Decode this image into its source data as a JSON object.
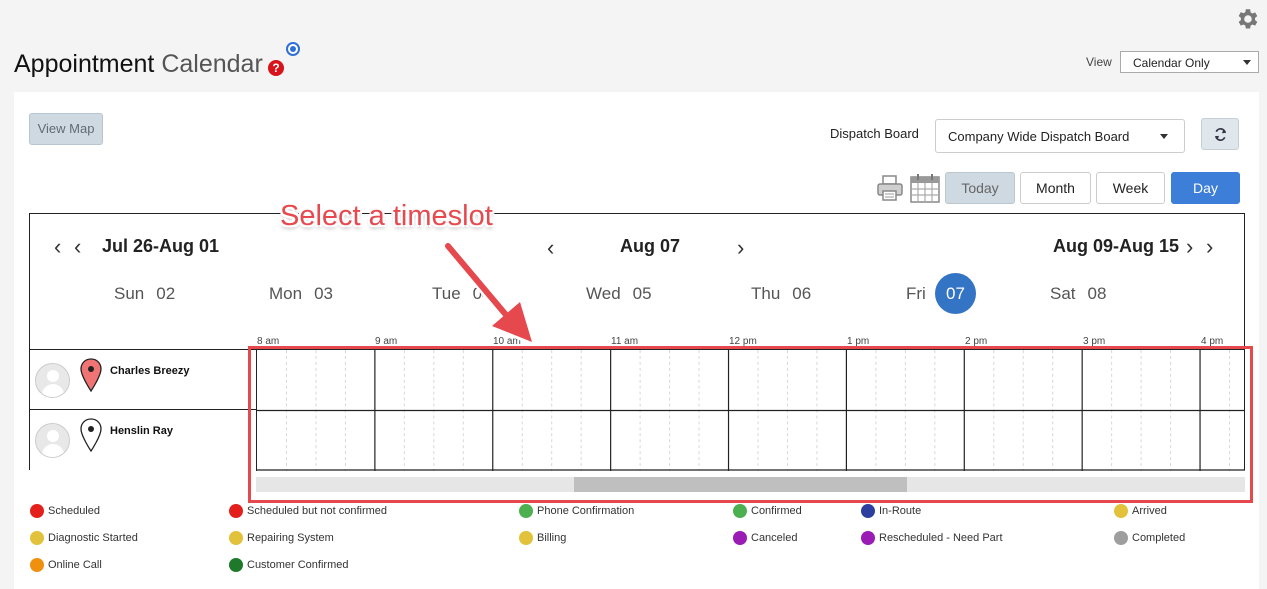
{
  "header": {
    "title_part1": "Appointment",
    "title_part2": "Calendar",
    "help_symbol": "?",
    "view_label": "View",
    "view_selected": "Calendar Only"
  },
  "toolbar": {
    "view_map_label": "View Map",
    "dispatch_label": "Dispatch Board",
    "dispatch_selected": "Company Wide Dispatch Board",
    "today_label": "Today",
    "month_label": "Month",
    "week_label": "Week",
    "day_label": "Day",
    "active_view": "Day"
  },
  "calendar": {
    "prev_range": "Jul 26-Aug 01",
    "current_date": "Aug 07",
    "next_range": "Aug 09-Aug 15",
    "days": [
      {
        "name": "Sun",
        "num": "02"
      },
      {
        "name": "Mon",
        "num": "03"
      },
      {
        "name": "Tue",
        "num": "04"
      },
      {
        "name": "Wed",
        "num": "05"
      },
      {
        "name": "Thu",
        "num": "06"
      },
      {
        "name": "Fri",
        "num": "07"
      },
      {
        "name": "Sat",
        "num": "08"
      }
    ],
    "selected_day_index": 5,
    "hours": [
      "8 am",
      "9 am",
      "10 am",
      "11 am",
      "12 pm",
      "1 pm",
      "2 pm",
      "3 pm",
      "4 pm"
    ],
    "technicians": [
      {
        "name": "Charles Breezy",
        "pin_color": "#f07474"
      },
      {
        "name": "Henslin Ray",
        "pin_color": "#ffffff"
      }
    ],
    "scroll_position": 0.32
  },
  "annotation": {
    "callout_text": "Select a timeslot",
    "color": "#e5484d"
  },
  "legend": [
    {
      "label": "Scheduled",
      "color": "#e3201b"
    },
    {
      "label": "Scheduled but not confirmed",
      "color": "#e3201b"
    },
    {
      "label": "Phone Confirmation",
      "color": "#4caf50"
    },
    {
      "label": "Confirmed",
      "color": "#4caf50"
    },
    {
      "label": "In-Route",
      "color": "#2c3e9e"
    },
    {
      "label": "Arrived",
      "color": "#e2c23a"
    },
    {
      "label": "Diagnostic Started",
      "color": "#e2c23a"
    },
    {
      "label": "Repairing System",
      "color": "#e2c23a"
    },
    {
      "label": "Billing",
      "color": "#e2c23a"
    },
    {
      "label": "Canceled",
      "color": "#9b1bb5"
    },
    {
      "label": "Rescheduled - Need Part",
      "color": "#9b1bb5"
    },
    {
      "label": "Completed",
      "color": "#9e9e9e"
    },
    {
      "label": "Online Call",
      "color": "#f0900f"
    },
    {
      "label": "Customer Confirmed",
      "color": "#1e7a2a"
    }
  ]
}
